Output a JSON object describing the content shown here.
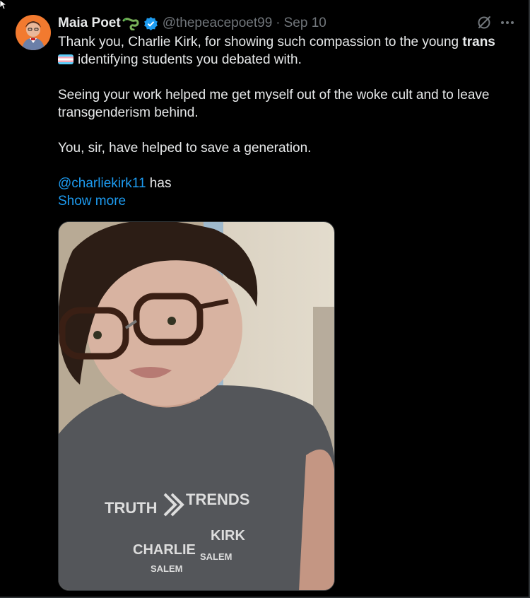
{
  "tweet": {
    "author": {
      "name": "Maia Poet",
      "handle": "@thepeacepoet99",
      "name_emoji_icon": "lizard-icon",
      "verified_icon": "verified-badge-icon",
      "verified_color": "#1d9bf0"
    },
    "separator": "·",
    "date": "Sep 10",
    "text": {
      "line1": "Thank you, Charlie Kirk, for showing such compassion to the young ",
      "line1_bold": "trans",
      "line2": "identifying students you debated with.",
      "para2": "Seeing your work helped me get myself out of the woke cult and to leave transgenderism behind.",
      "para3": "You, sir, have helped to save a generation.",
      "mention": "@charliekirk11",
      "after_mention": " has"
    },
    "show_more": "Show more",
    "flag_icon": "transgender-flag-icon",
    "media": {
      "shirt_text_1": "TRUTH",
      "shirt_text_2": "TRENDS",
      "shirt_text_3": "CHARLIE",
      "shirt_text_4": "KIRK",
      "shirt_text_5": "SALEM",
      "shirt_text_6": "SALEM"
    }
  },
  "colors": {
    "background": "#000000",
    "text": "#e7e9ea",
    "muted": "#71767b",
    "link": "#1d9bf0"
  },
  "icons": [
    "grok-icon",
    "more-options-icon",
    "cursor-icon"
  ]
}
